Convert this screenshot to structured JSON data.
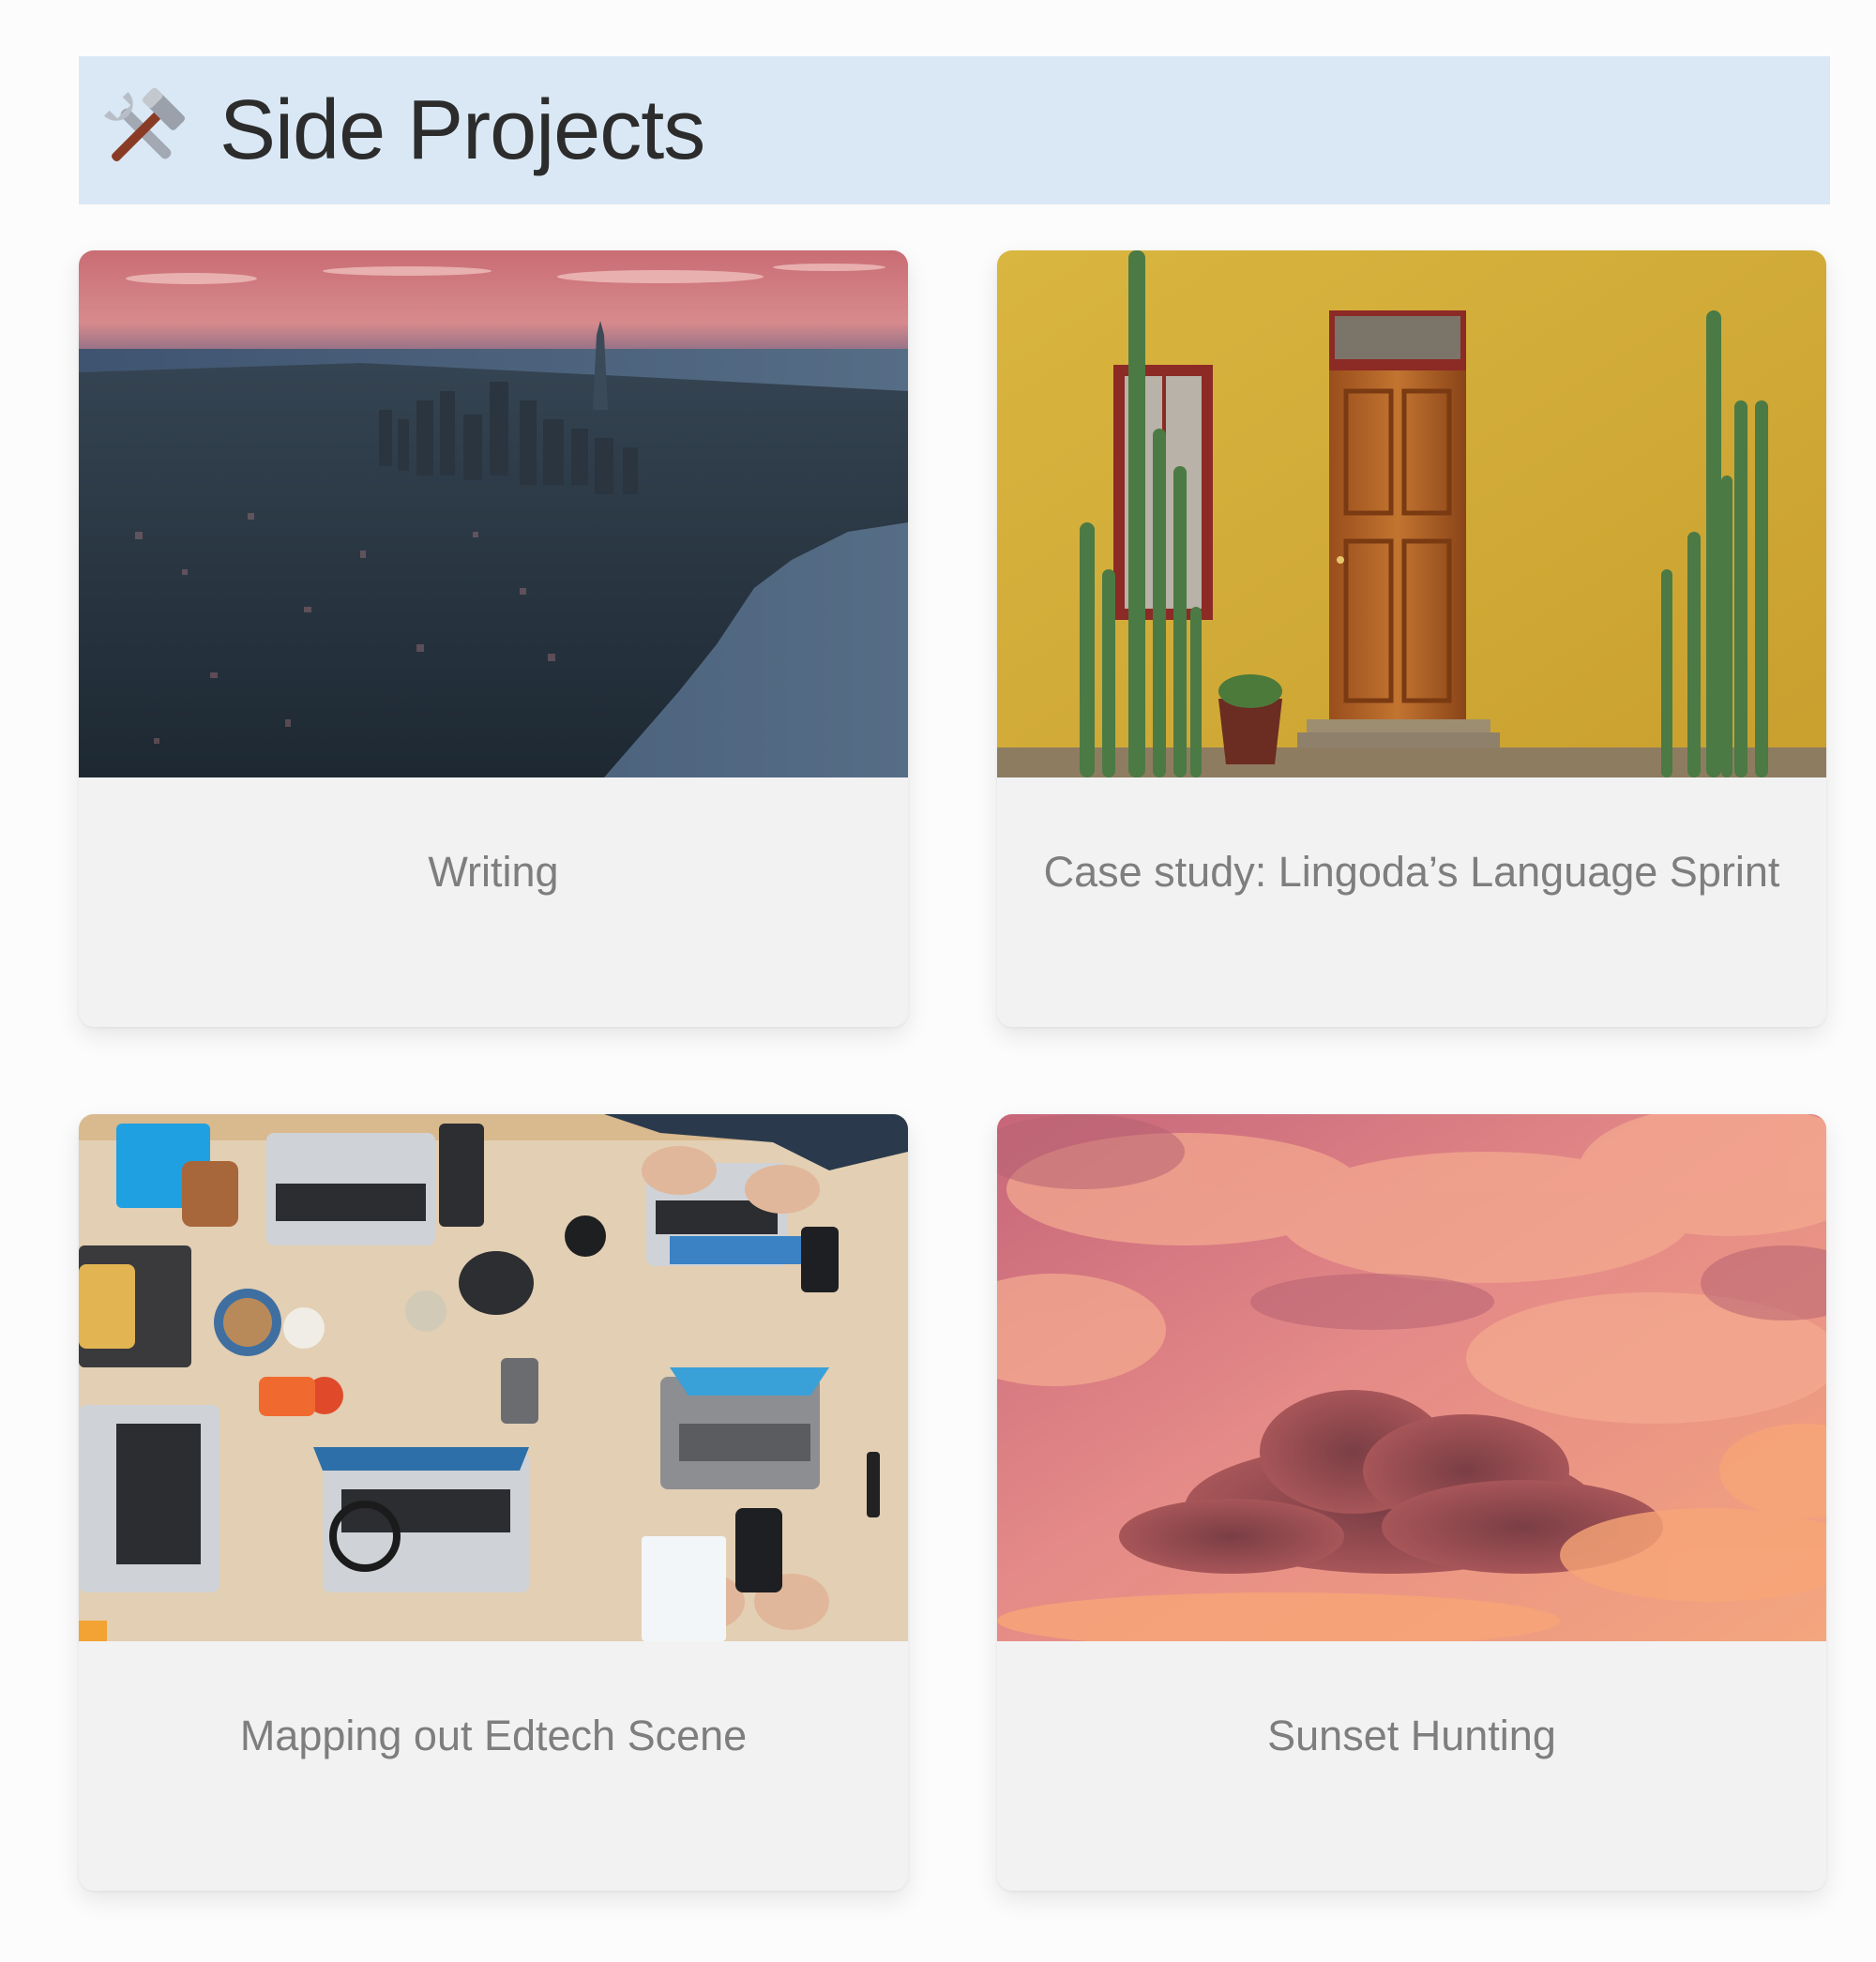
{
  "header": {
    "icon": "hammer-and-wrench-icon",
    "title": "Side Projects",
    "background": "#d9e8f4"
  },
  "cards": [
    {
      "caption": "Writing",
      "image": "aerial-city-skyline-at-sunset"
    },
    {
      "caption": "Case study: Lingoda’s Language Sprint",
      "image": "yellow-wall-wooden-door-cacti"
    },
    {
      "caption": "Mapping out Edtech Scene",
      "image": "team-laptops-on-wooden-table"
    },
    {
      "caption": "Sunset Hunting",
      "image": "pink-sunset-clouds"
    }
  ]
}
